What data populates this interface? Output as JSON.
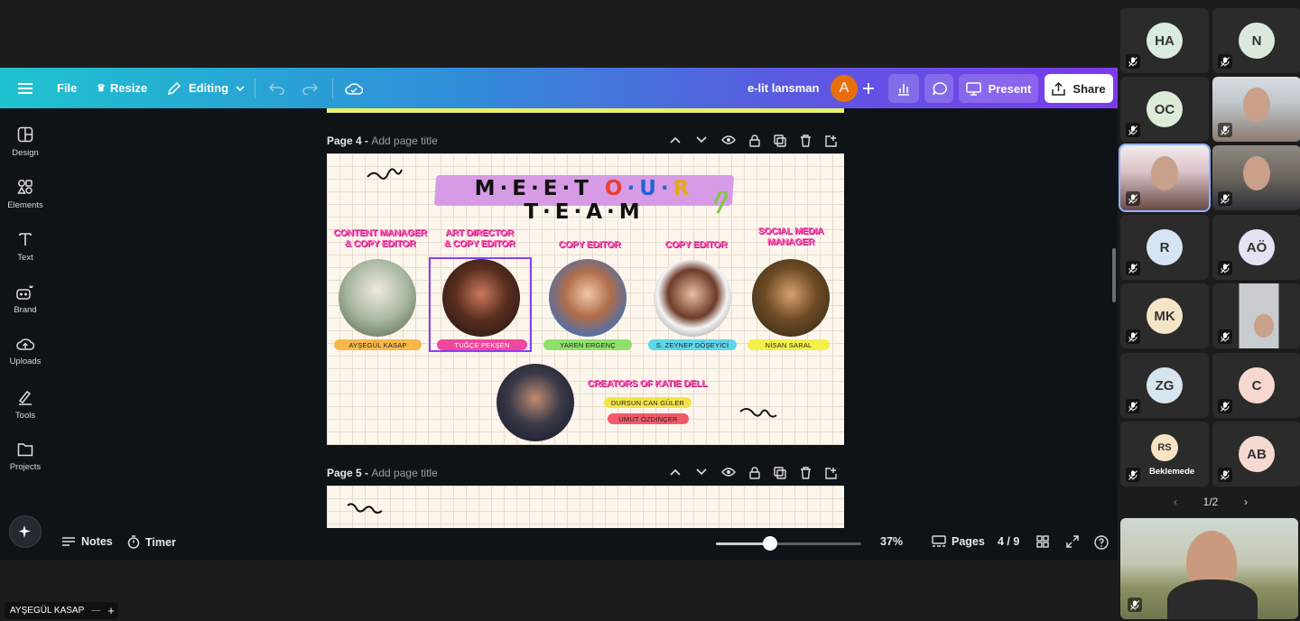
{
  "topbar": {
    "file": "File",
    "resize": "Resize",
    "editing": "Editing",
    "doc_title": "e-lit lansman",
    "avatar_initial": "A",
    "present": "Present",
    "share": "Share"
  },
  "sidebar": {
    "items": [
      {
        "label": "Design",
        "icon": "design-icon"
      },
      {
        "label": "Elements",
        "icon": "elements-icon"
      },
      {
        "label": "Text",
        "icon": "text-icon"
      },
      {
        "label": "Brand",
        "icon": "brand-icon"
      },
      {
        "label": "Uploads",
        "icon": "uploads-icon"
      },
      {
        "label": "Tools",
        "icon": "tools-icon"
      },
      {
        "label": "Projects",
        "icon": "projects-icon"
      }
    ]
  },
  "pages": {
    "page4_label": "Page 4 -",
    "page4_placeholder": "Add page title",
    "page5_label": "Page 5 -",
    "page5_placeholder": "Add page title"
  },
  "slide": {
    "title": "MEETOURTEAM",
    "members": [
      {
        "role1": "CONTENT MANAGER",
        "role2": "& COPY EDITOR",
        "name": "AYŞEGÜL KASAP",
        "tag_color": "#f7b84a"
      },
      {
        "role1": "ART DIRECTOR",
        "role2": "& COPY EDITOR",
        "name": "TUĞÇE PEKŞEN",
        "tag_color": "#f0489c"
      },
      {
        "role1": "COPY EDITOR",
        "role2": "",
        "name": "YAREN ERGENÇ",
        "tag_color": "#8ee06a"
      },
      {
        "role1": "COPY EDITOR",
        "role2": "",
        "name": "S. ZEYNEP DÖŞEYİCİ",
        "tag_color": "#5fd6e8"
      },
      {
        "role1": "SOCIAL MEDIA",
        "role2": "MANAGER",
        "name": "NİSAN SARAL",
        "tag_color": "#f3f04a"
      }
    ],
    "creators_title": "CREATORS OF KATIE DELL",
    "creator1": "DURSUN CAN GÜLER",
    "creator2": "UMUT ÖZDİNÇER"
  },
  "bottombar": {
    "notes": "Notes",
    "timer": "Timer",
    "zoom": "37%",
    "zoom_level": 0.37,
    "pages": "Pages",
    "page_count": "4 / 9"
  },
  "meeting": {
    "participants": [
      {
        "initials": "HA",
        "color": "#d9ecdf"
      },
      {
        "initials": "N",
        "color": "#dbe9dd"
      },
      {
        "initials": "OC",
        "color": "#dcecd8"
      },
      {
        "initials": "",
        "color": "video"
      },
      {
        "initials": "",
        "color": "video-active"
      },
      {
        "initials": "",
        "color": "video"
      },
      {
        "initials": "R",
        "color": "#d6e4f5"
      },
      {
        "initials": "AÖ",
        "color": "#e5e3f2"
      },
      {
        "initials": "MK",
        "color": "#f4e5c8"
      },
      {
        "initials": "",
        "color": "video"
      },
      {
        "initials": "ZG",
        "color": "#d7e6ee"
      },
      {
        "initials": "C",
        "color": "#f7d8cf"
      },
      {
        "initials": "RS",
        "color": "#f8e3c4"
      },
      {
        "initials": "AB",
        "color": "#f3d9cf"
      }
    ],
    "waiting_label": "Beklemede",
    "pager": "1/2",
    "bottom_name": "AYŞEGÜL KASAP"
  }
}
